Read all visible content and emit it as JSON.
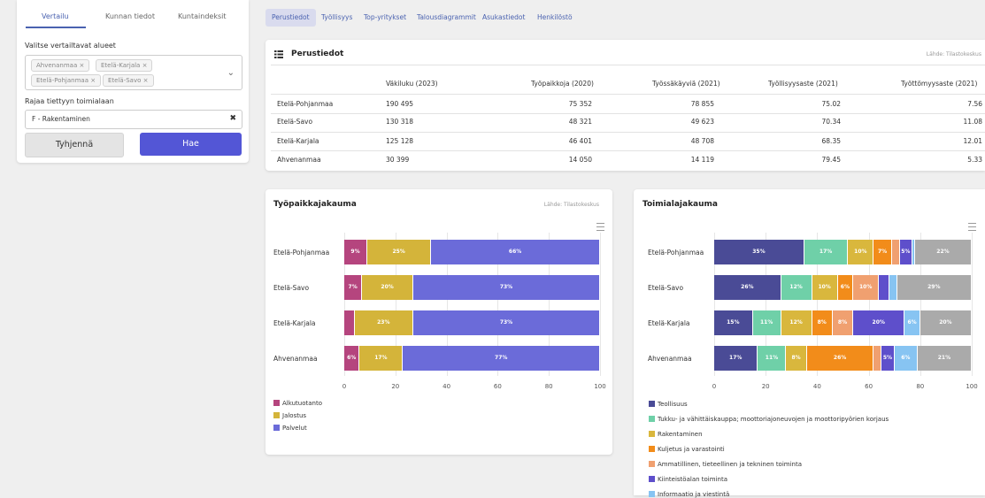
{
  "left_tabs": [
    "Vertailu",
    "Kunnan tiedot",
    "Kuntaindeksit"
  ],
  "compare_label": "Valitse vertailtavat alueet",
  "tags": [
    "Ahvenanmaa",
    "Etelä-Karjala",
    "Etelä-Pohjanmaa",
    "Etelä-Savo"
  ],
  "tag_remove_glyph": "×",
  "chevron_glyph": "⌄",
  "industry_label": "Rajaa tiettyyn toimialaan",
  "industry_value": "F - Rakentaminen",
  "clear_glyph": "✖",
  "clear_button": "Tyhjennä",
  "search_button": "Hae",
  "top_tabs": [
    "Perustiedot",
    "Työllisyys",
    "Top-yritykset",
    "Talousdiagrammit",
    "Asukastiedot",
    "Henkilöstö"
  ],
  "table": {
    "title": "Perustiedot",
    "source": "Lähde: Tilastokeskus",
    "columns": [
      "Väkiluku (2023)",
      "Työpaikkoja (2020)",
      "Työssäkäyviä (2021)",
      "Työllisyysaste (2021)",
      "Työttömyysaste (2021)"
    ],
    "rows": [
      {
        "name": "Etelä-Pohjanmaa",
        "cells": [
          "190 495",
          "75 352",
          "78 855",
          "75.02",
          "7.56"
        ]
      },
      {
        "name": "Etelä-Savo",
        "cells": [
          "130 318",
          "48 321",
          "49 623",
          "70.34",
          "11.08"
        ]
      },
      {
        "name": "Etelä-Karjala",
        "cells": [
          "125 128",
          "46 401",
          "48 708",
          "68.35",
          "12.01"
        ]
      },
      {
        "name": "Ahvenanmaa",
        "cells": [
          "30 399",
          "14 050",
          "14 119",
          "79.45",
          "5.33"
        ]
      }
    ]
  },
  "chart_data": [
    {
      "type": "bar",
      "stacked": true,
      "orientation": "horizontal",
      "title": "Työpaikkajakauma",
      "source": "Lähde: Tilastokeskus",
      "categories": [
        "Etelä-Pohjanmaa",
        "Etelä-Savo",
        "Etelä-Karjala",
        "Ahvenanmaa"
      ],
      "xlim": [
        0,
        100
      ],
      "ticks": [
        0,
        20,
        40,
        60,
        80,
        100
      ],
      "series": [
        {
          "name": "Alkutuotanto",
          "color": "#b5457e",
          "values": [
            9,
            7,
            4,
            6
          ],
          "labels": [
            "9%",
            "7%",
            "",
            "6%"
          ]
        },
        {
          "name": "Jalostus",
          "color": "#d4b43a",
          "values": [
            25,
            20,
            23,
            17
          ],
          "labels": [
            "25%",
            "20%",
            "23%",
            "17%"
          ]
        },
        {
          "name": "Palvelut",
          "color": "#6b6bd9",
          "values": [
            66,
            73,
            73,
            77
          ],
          "labels": [
            "66%",
            "73%",
            "73%",
            "77%"
          ]
        }
      ]
    },
    {
      "type": "bar",
      "stacked": true,
      "orientation": "horizontal",
      "title": "Toimialajakauma",
      "categories": [
        "Etelä-Pohjanmaa",
        "Etelä-Savo",
        "Etelä-Karjala",
        "Ahvenanmaa"
      ],
      "xlim": [
        0,
        100
      ],
      "ticks": [
        0,
        20,
        40,
        60,
        80,
        100
      ],
      "series": [
        {
          "name": "Teollisuus",
          "color": "#4a4b96",
          "values": [
            35,
            26,
            15,
            17
          ],
          "labels": [
            "35%",
            "26%",
            "15%",
            "17%"
          ]
        },
        {
          "name": "Tukku- ja vähittäiskauppa; moottoriajoneuvojen ja moottoripyörien korjaus",
          "color": "#6fd0a8",
          "values": [
            17,
            12,
            11,
            11
          ],
          "labels": [
            "17%",
            "12%",
            "11%",
            "11%"
          ]
        },
        {
          "name": "Rakentaminen",
          "color": "#d9b73d",
          "values": [
            10,
            10,
            12,
            8
          ],
          "labels": [
            "10%",
            "10%",
            "12%",
            "8%"
          ]
        },
        {
          "name": "Kuljetus ja varastointi",
          "color": "#f28c1a",
          "values": [
            7,
            6,
            8,
            26
          ],
          "labels": [
            "7%",
            "6%",
            "8%",
            "26%"
          ]
        },
        {
          "name": "Ammatillinen, tieteellinen ja tekninen toiminta",
          "color": "#f0a070",
          "values": [
            3,
            10,
            8,
            3
          ],
          "labels": [
            "",
            "10%",
            "8%",
            ""
          ]
        },
        {
          "name": "Kiinteistöalan toiminta",
          "color": "#5e4fcb",
          "values": [
            5,
            4,
            20,
            5
          ],
          "labels": [
            "5%",
            "",
            "20%",
            "5%"
          ]
        },
        {
          "name": "Informaatio ja viestintä",
          "color": "#87c4f2",
          "values": [
            1,
            3,
            6,
            9
          ],
          "labels": [
            "",
            "",
            "6%",
            "6%"
          ]
        },
        {
          "name": "",
          "color": "#aaaaaa",
          "values": [
            22,
            29,
            20,
            21
          ],
          "labels": [
            "22%",
            "29%",
            "20%",
            "21%"
          ]
        }
      ]
    }
  ]
}
